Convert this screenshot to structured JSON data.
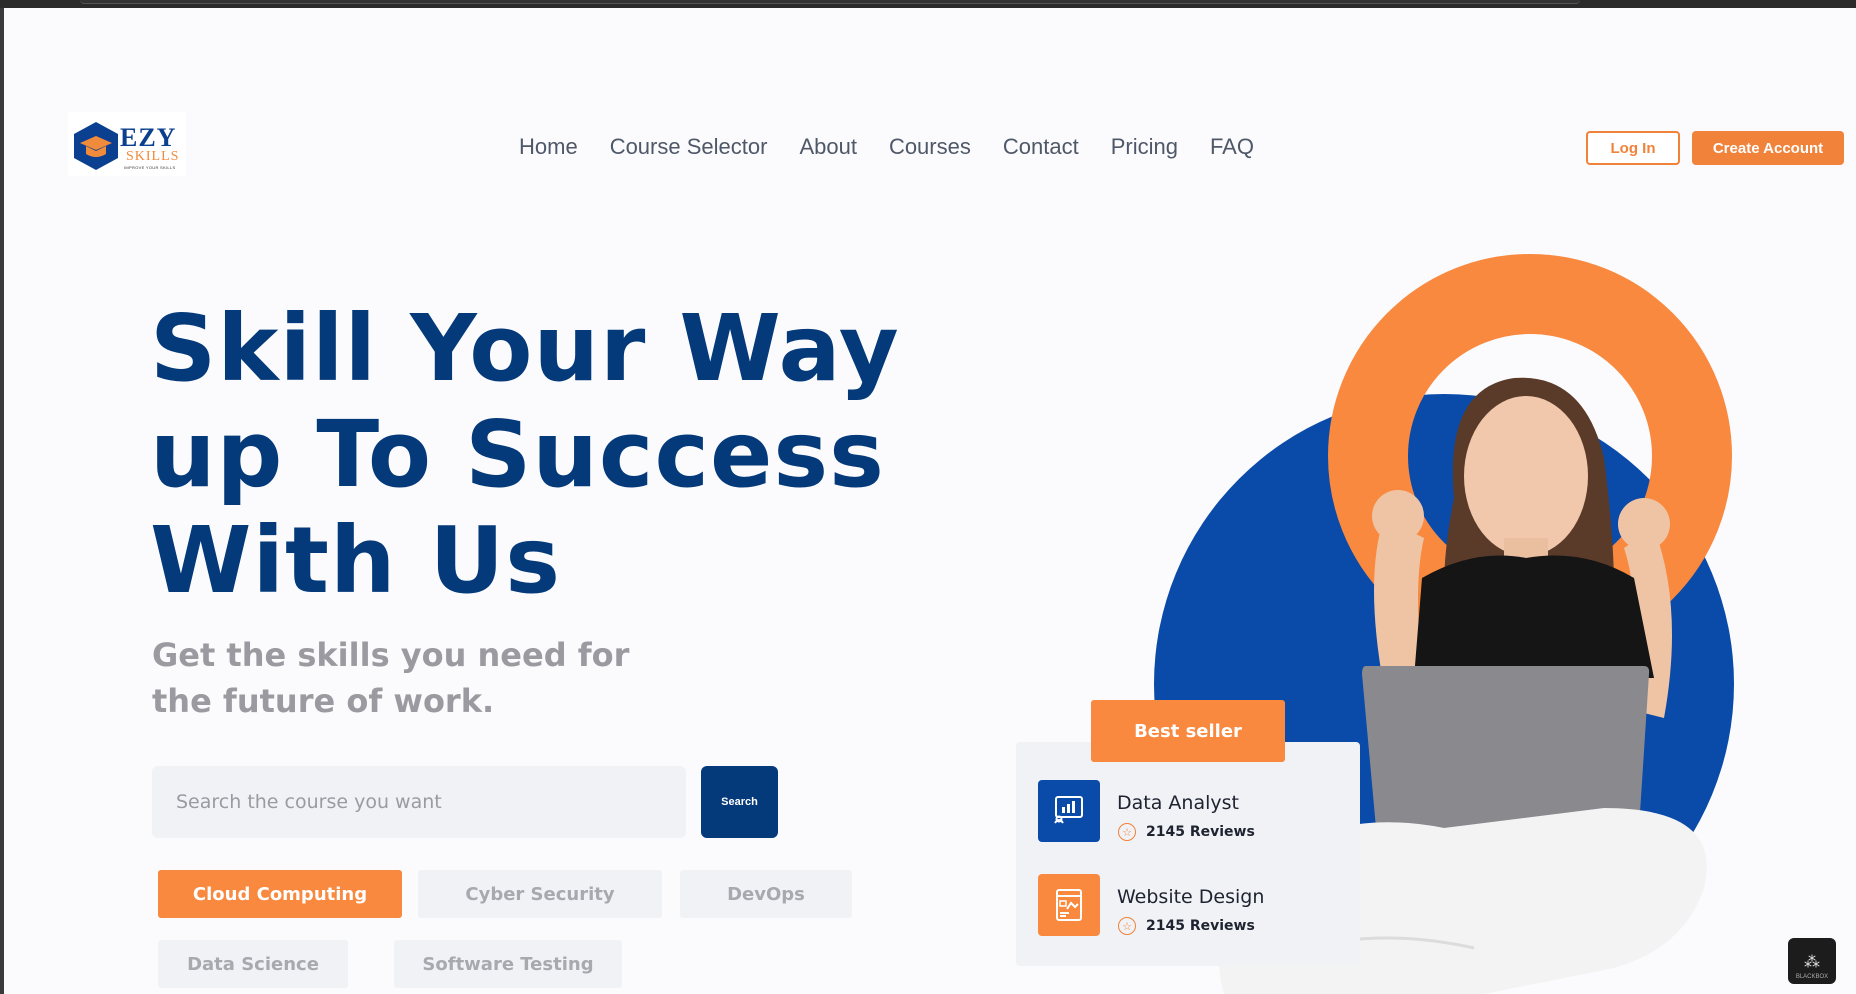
{
  "logo": {
    "word": "EZY",
    "sub": "SKILLS",
    "tagline": "IMPROVE YOUR SKILLS"
  },
  "nav": [
    "Home",
    "Course Selector",
    "About",
    "Courses",
    "Contact",
    "Pricing",
    "FAQ"
  ],
  "auth": {
    "login": "Log In",
    "create": "Create Account"
  },
  "hero": {
    "title_line1": "Skill Your Way",
    "title_line2": "up To Success",
    "title_line3": "With Us",
    "subtitle_line1": "Get the skills you need for",
    "subtitle_line2": "the future of work."
  },
  "search": {
    "placeholder": "Search the course you want",
    "button": "Search"
  },
  "chips": [
    "Cloud Computing",
    "Cyber Security",
    "DevOps",
    "Data Science",
    "Software Testing"
  ],
  "card": {
    "badge": "Best seller",
    "courses": [
      {
        "title": "Data Analyst",
        "reviews": "2145 Reviews",
        "icon": "chart-presentation-icon"
      },
      {
        "title": "Website Design",
        "reviews": "2145 Reviews",
        "icon": "web-design-icon"
      }
    ]
  },
  "widget": {
    "label": "BLACKBOX"
  },
  "colors": {
    "brand_blue": "#04397a",
    "accent_orange": "#f8893f",
    "circle_blue": "#0a4aa8"
  }
}
